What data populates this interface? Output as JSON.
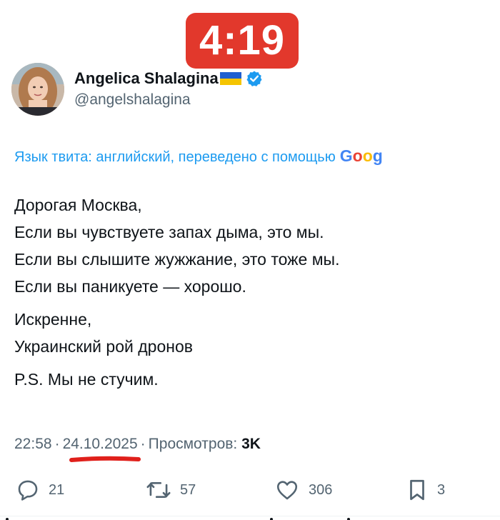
{
  "timer": {
    "text": "4:19",
    "color": "#e2382c"
  },
  "author": {
    "name": "Angelica Shalagina",
    "handle": "@angelshalagina",
    "flag_icon": "ukraine-flag-icon",
    "verified_icon": "verified-badge-icon",
    "verified_color": "#1d9bf0"
  },
  "translation": {
    "text": "Язык твита: английский, переведено с помощью",
    "google_letters": [
      "G",
      "o",
      "o",
      "g"
    ]
  },
  "tweet": {
    "paragraphs": [
      [
        "Дорогая Москва,",
        "Если вы чувствуете запах дыма, это мы.",
        "Если вы слышите жужжание, это тоже мы.",
        "Если вы паникуете — хорошо."
      ],
      [
        "Искренне,",
        "Украинский рой дронов"
      ],
      [
        "P.S. Мы не стучим."
      ]
    ]
  },
  "meta": {
    "time": "22:58",
    "date": "24.10.2025",
    "views_label": "Просмотров:",
    "views_count": "3K"
  },
  "actions": {
    "reply_count": "21",
    "retweet_count": "57",
    "like_count": "306",
    "bookmark_count": "3"
  },
  "colors": {
    "link_blue": "#1d9bf0",
    "secondary_text": "#536471",
    "primary_text": "#0f1419",
    "annotation_red": "#e0201b"
  }
}
